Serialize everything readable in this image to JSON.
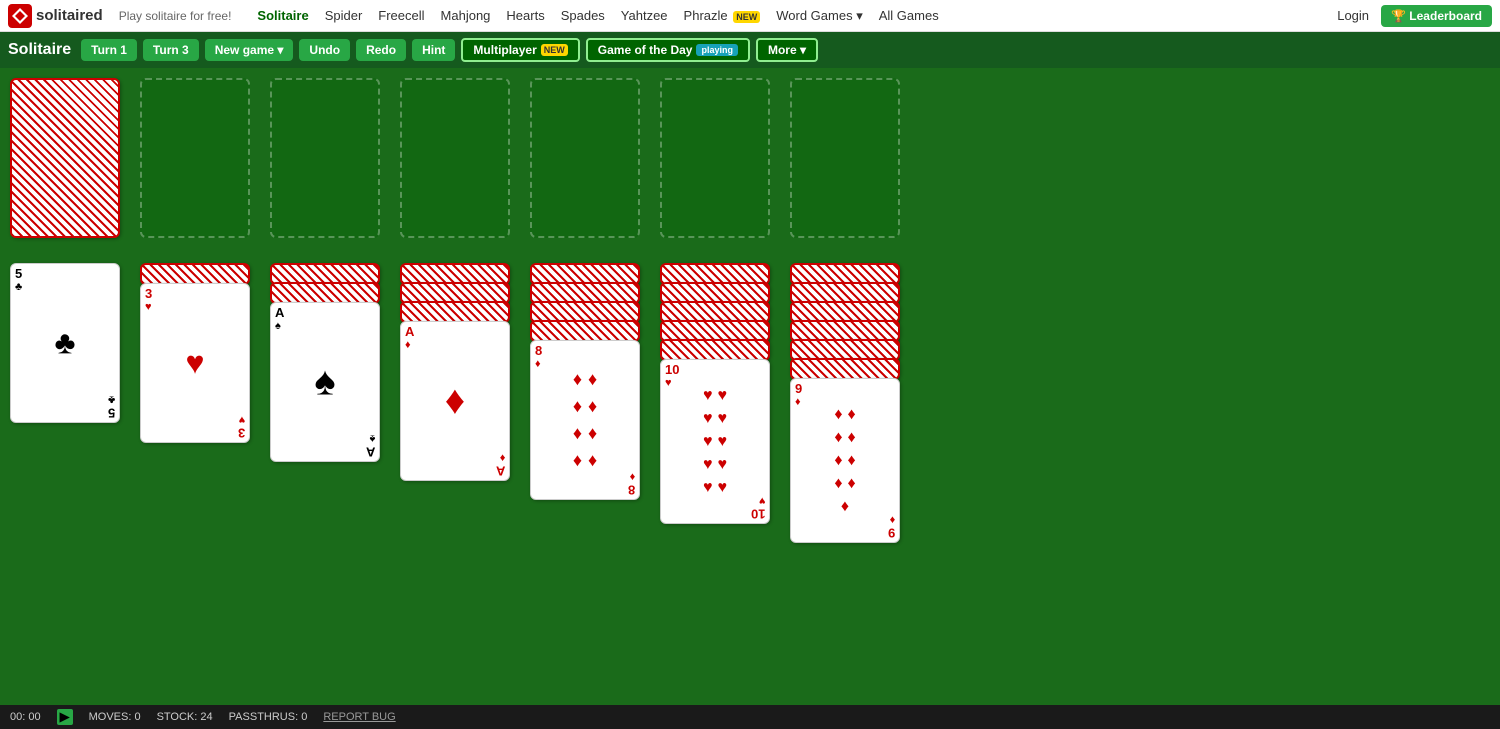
{
  "nav": {
    "logo_text": "solitaired",
    "tagline": "Play solitaire for free!",
    "links": [
      {
        "label": "Solitaire",
        "active": true
      },
      {
        "label": "Spider"
      },
      {
        "label": "Freecell"
      },
      {
        "label": "Mahjong"
      },
      {
        "label": "Hearts"
      },
      {
        "label": "Spades"
      },
      {
        "label": "Yahtzee"
      },
      {
        "label": "Phrazle",
        "badge": "NEW"
      },
      {
        "label": "Word Games",
        "dropdown": true
      },
      {
        "label": "All Games"
      }
    ],
    "login": "Login",
    "leaderboard": "🏆 Leaderboard"
  },
  "toolbar": {
    "title": "Solitaire",
    "turn1": "Turn 1",
    "turn3": "Turn 3",
    "new_game": "New game",
    "undo": "Undo",
    "redo": "Redo",
    "hint": "Hint",
    "multiplayer": "Multiplayer",
    "multiplayer_badge": "NEW",
    "gotd": "Game of the Day",
    "gotd_badge": "playing",
    "more": "More ▾"
  },
  "status": {
    "time": "00: 00",
    "moves_label": "MOVES:",
    "moves": "0",
    "stock_label": "STOCK:",
    "stock": "24",
    "passthrus_label": "PASSTHRUS:",
    "passthrus": "0",
    "report_bug": "REPORT BUG"
  }
}
